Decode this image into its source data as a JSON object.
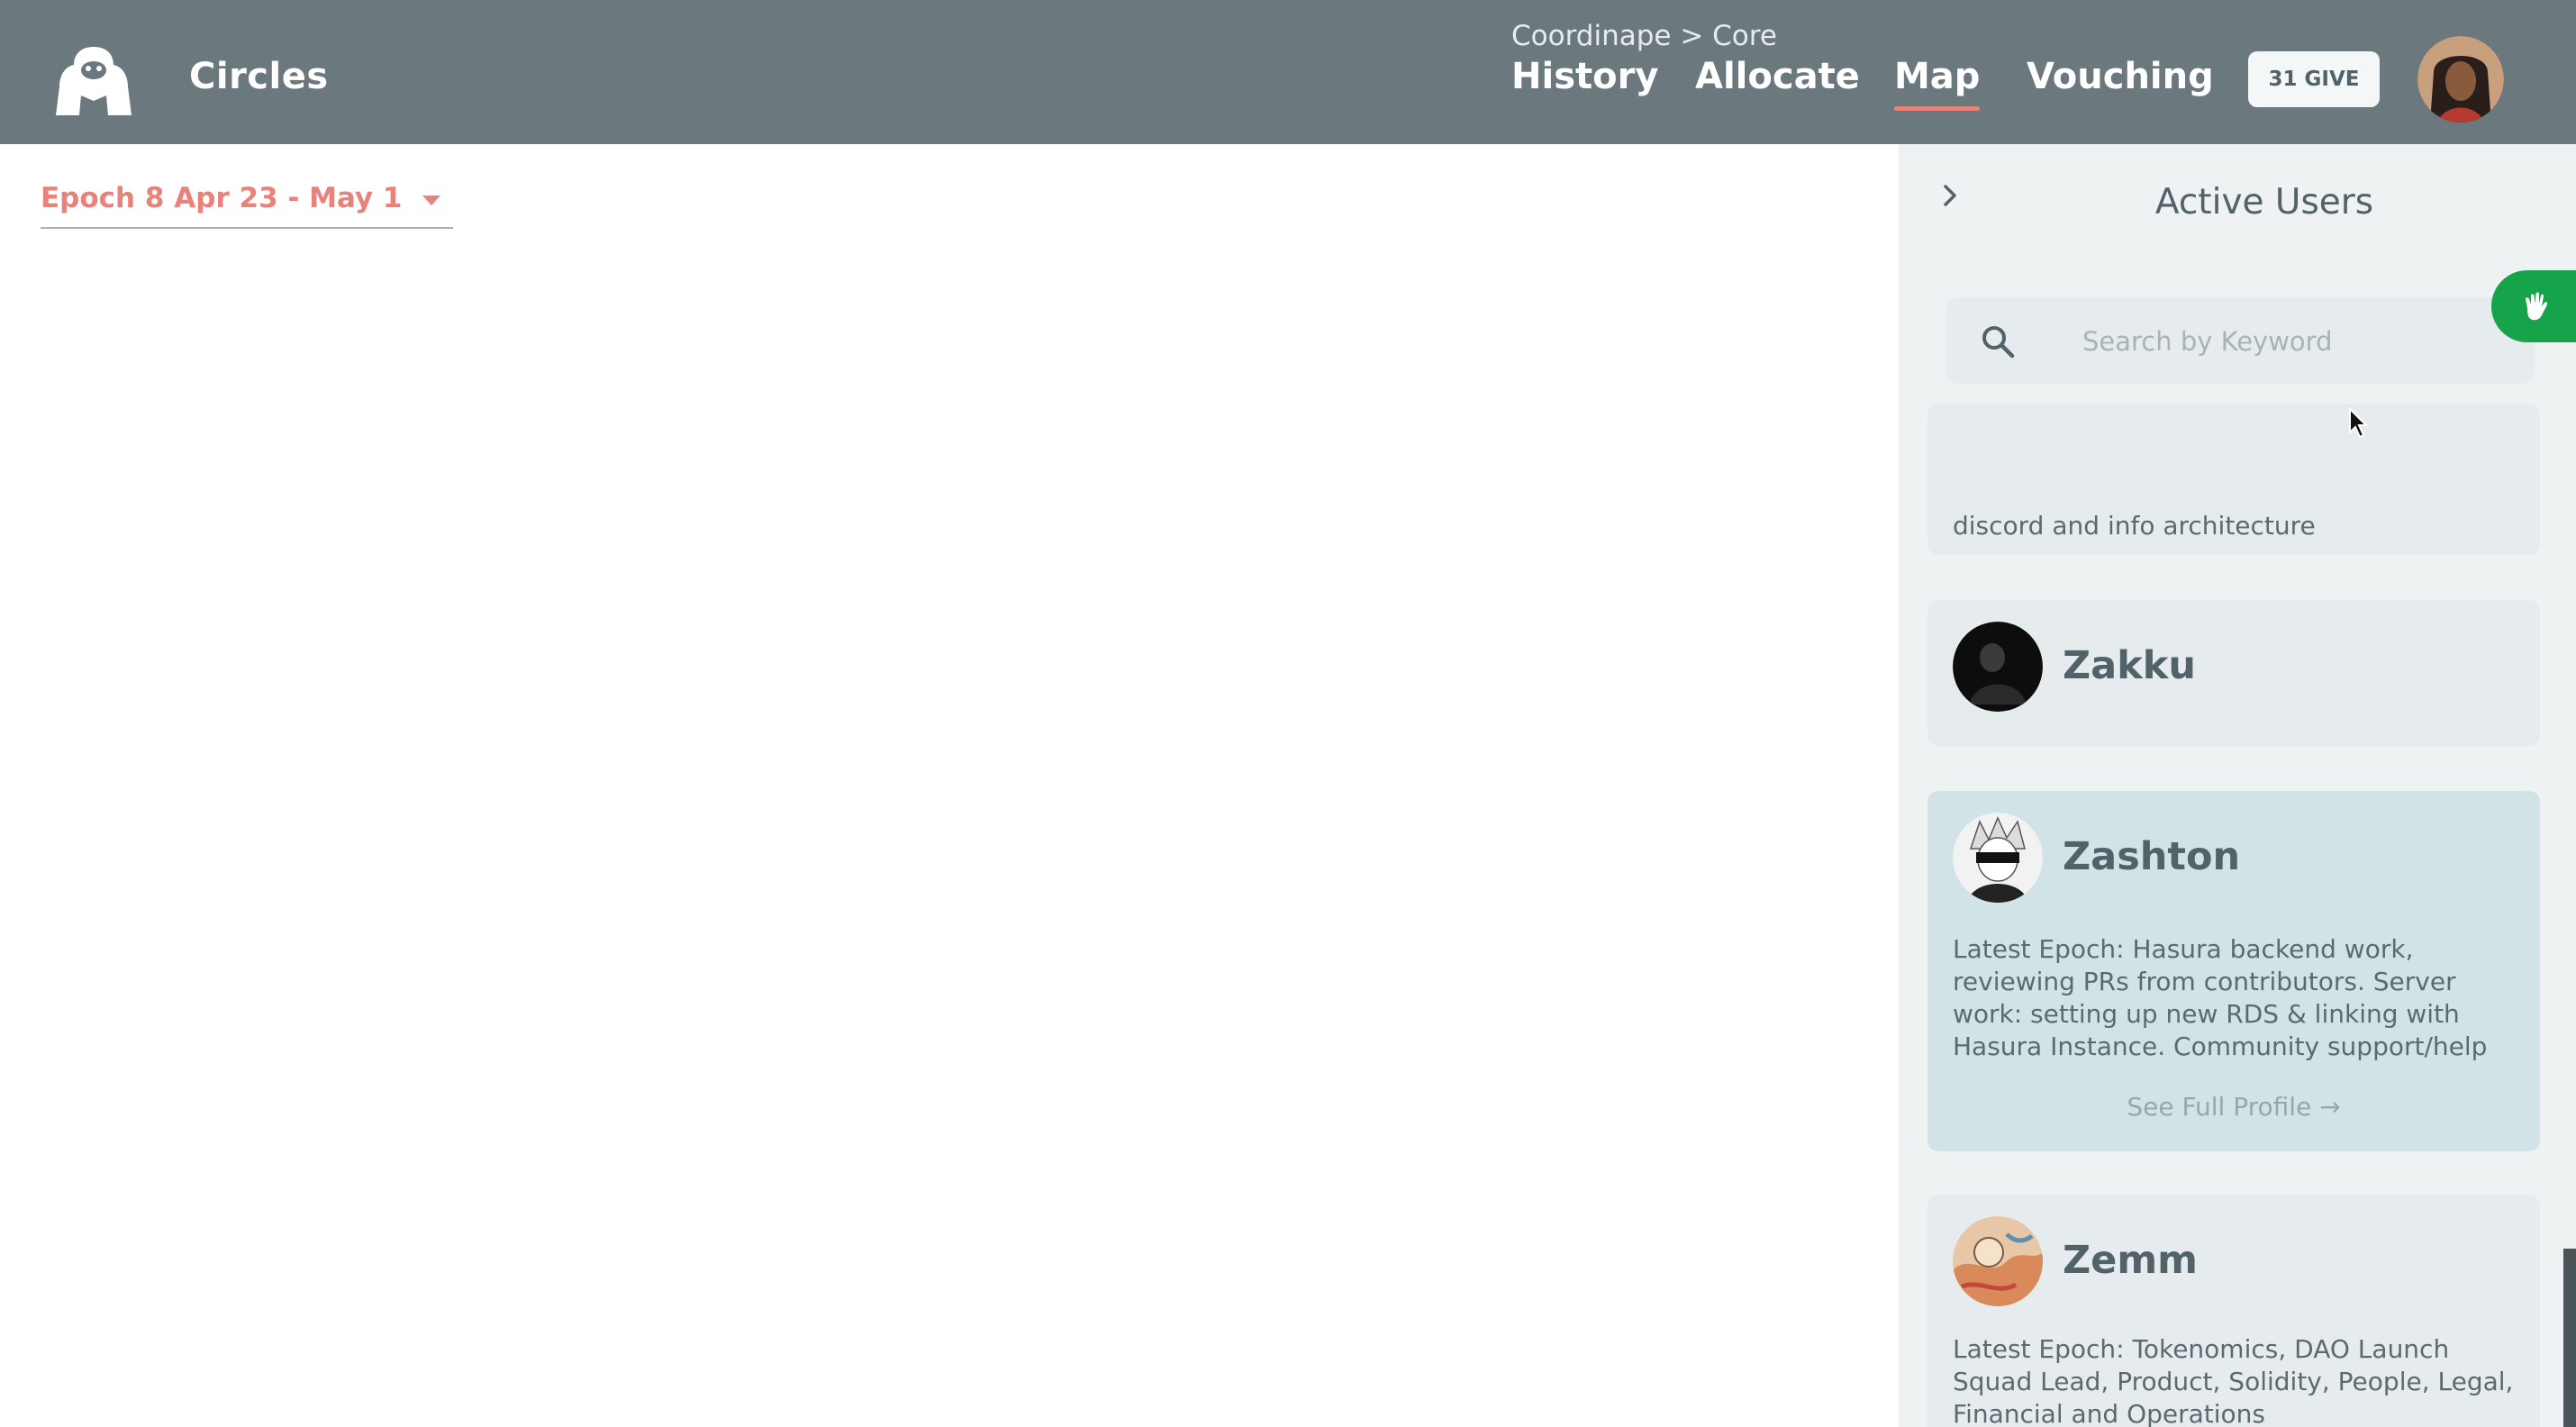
{
  "header": {
    "brand": "Circles",
    "breadcrumb": "Coordinape > Core",
    "nav": [
      {
        "label": "History"
      },
      {
        "label": "Allocate"
      },
      {
        "label": "Map"
      },
      {
        "label": "Vouching"
      }
    ],
    "give_button": "31 GIVE"
  },
  "epoch": {
    "label": "Epoch 8 Apr 23 - May 1"
  },
  "drawer": {
    "title": "Active Users",
    "search": {
      "placeholder": "Search by Keyword",
      "value": ""
    },
    "users": [
      {
        "name": "",
        "bio": "discord and info architecture"
      },
      {
        "name": "Zakku",
        "bio": ""
      },
      {
        "name": "Zashton",
        "bio": "Latest Epoch: Hasura backend work, reviewing PRs from contributors. Server work: setting up new RDS & linking with Hasura Instance. Community support/help",
        "profile_link": "See Full Profile →"
      },
      {
        "name": "Zemm",
        "bio": "Latest Epoch: Tokenomics, DAO Launch Squad Lead, Product, Solidity, People, Legal, Financial and Operations"
      }
    ]
  },
  "colors": {
    "header_bg": "#6b797e",
    "accent": "#e8827a",
    "drawer_bg": "#eef2f3",
    "card_bg": "#e6ecee",
    "card_highlight": "#d1e3e6",
    "wave_button": "#16a34a"
  },
  "icons": {
    "logo": "gorilla-logo-icon",
    "search": "search-icon",
    "drawer_toggle": "chevron-right-icon",
    "wave": "waving-hand-icon",
    "epoch_caret": "caret-down-icon"
  }
}
